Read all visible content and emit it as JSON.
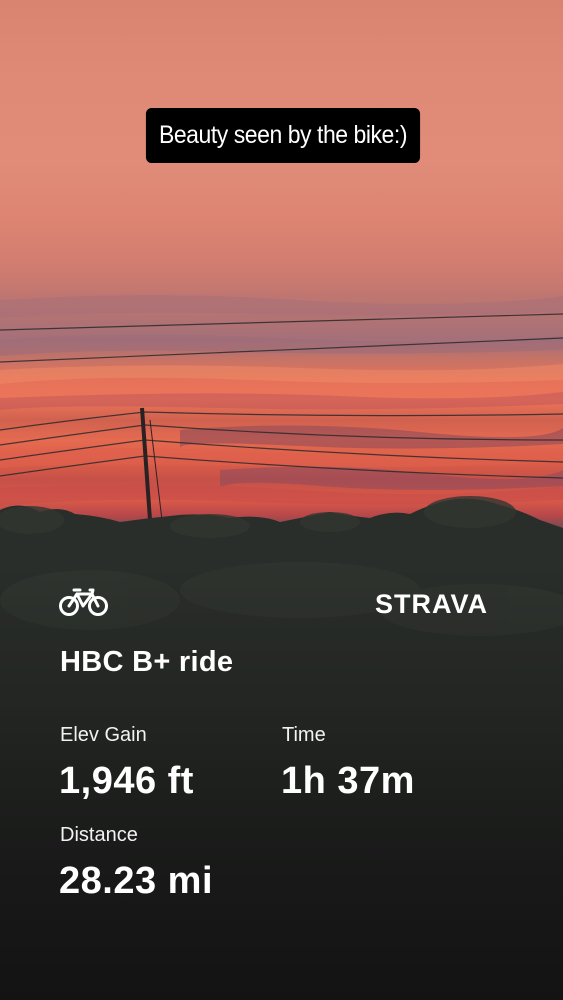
{
  "caption": {
    "text": "Beauty seen by the bike:)"
  },
  "activity": {
    "icon": "bike-icon",
    "brand": "STRAVA",
    "title": "HBC B+ ride",
    "stats": {
      "elev_gain": {
        "label": "Elev Gain",
        "value": "1,946 ft"
      },
      "time": {
        "label": "Time",
        "value": "1h 37m"
      },
      "distance": {
        "label": "Distance",
        "value": "28.23 mi"
      }
    }
  },
  "colors": {
    "text": "#ffffff",
    "caption_bg": "#000000",
    "sky_top": "#d98470",
    "sunset_glow": "#e5725a",
    "ground": "#262826"
  }
}
